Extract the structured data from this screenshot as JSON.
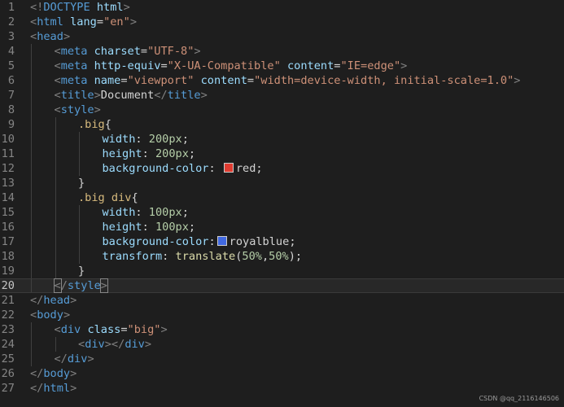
{
  "editor": {
    "current_line": 20,
    "lines": [
      {
        "n": "1",
        "t": [
          [
            "br",
            "<!"
          ],
          [
            "tag",
            "DOCTYPE"
          ],
          [
            "txt",
            " "
          ],
          [
            "attr",
            "html"
          ],
          [
            "br",
            ">"
          ]
        ]
      },
      {
        "n": "2",
        "t": [
          [
            "br",
            "<"
          ],
          [
            "tag",
            "html"
          ],
          [
            "txt",
            " "
          ],
          [
            "attr",
            "lang"
          ],
          [
            "txt",
            "="
          ],
          [
            "str",
            "\"en\""
          ],
          [
            "br",
            ">"
          ]
        ]
      },
      {
        "n": "3",
        "t": [
          [
            "br",
            "<"
          ],
          [
            "tag",
            "head"
          ],
          [
            "br",
            ">"
          ]
        ]
      },
      {
        "n": "4",
        "i": 1,
        "t": [
          [
            "br",
            "<"
          ],
          [
            "tag",
            "meta"
          ],
          [
            "txt",
            " "
          ],
          [
            "attr",
            "charset"
          ],
          [
            "txt",
            "="
          ],
          [
            "str",
            "\"UTF-8\""
          ],
          [
            "br",
            ">"
          ]
        ]
      },
      {
        "n": "5",
        "i": 1,
        "t": [
          [
            "br",
            "<"
          ],
          [
            "tag",
            "meta"
          ],
          [
            "txt",
            " "
          ],
          [
            "attr",
            "http-equiv"
          ],
          [
            "txt",
            "="
          ],
          [
            "str",
            "\"X-UA-Compatible\""
          ],
          [
            "txt",
            " "
          ],
          [
            "attr",
            "content"
          ],
          [
            "txt",
            "="
          ],
          [
            "str",
            "\"IE=edge\""
          ],
          [
            "br",
            ">"
          ]
        ]
      },
      {
        "n": "6",
        "i": 1,
        "t": [
          [
            "br",
            "<"
          ],
          [
            "tag",
            "meta"
          ],
          [
            "txt",
            " "
          ],
          [
            "attr",
            "name"
          ],
          [
            "txt",
            "="
          ],
          [
            "str",
            "\"viewport\""
          ],
          [
            "txt",
            " "
          ],
          [
            "attr",
            "content"
          ],
          [
            "txt",
            "="
          ],
          [
            "str",
            "\"width=device-width, initial-scale=1.0\""
          ],
          [
            "br",
            ">"
          ]
        ]
      },
      {
        "n": "7",
        "i": 1,
        "t": [
          [
            "br",
            "<"
          ],
          [
            "tag",
            "title"
          ],
          [
            "br",
            ">"
          ],
          [
            "txt",
            "Document"
          ],
          [
            "br",
            "</"
          ],
          [
            "tag",
            "title"
          ],
          [
            "br",
            ">"
          ]
        ]
      },
      {
        "n": "8",
        "i": 1,
        "t": [
          [
            "br",
            "<"
          ],
          [
            "tag",
            "style"
          ],
          [
            "br",
            ">"
          ]
        ]
      },
      {
        "n": "9",
        "i": 2,
        "t": [
          [
            "sel",
            ".big"
          ],
          [
            "punc",
            "{"
          ]
        ]
      },
      {
        "n": "10",
        "i": 3,
        "t": [
          [
            "prop",
            "width"
          ],
          [
            "punc",
            ": "
          ],
          [
            "num",
            "200px"
          ],
          [
            "punc",
            ";"
          ]
        ]
      },
      {
        "n": "11",
        "i": 3,
        "t": [
          [
            "prop",
            "height"
          ],
          [
            "punc",
            ": "
          ],
          [
            "num",
            "200px"
          ],
          [
            "punc",
            ";"
          ]
        ]
      },
      {
        "n": "12",
        "i": 3,
        "t": [
          [
            "prop",
            "background-color"
          ],
          [
            "punc",
            ": "
          ],
          [
            "swatch",
            "#e03c31"
          ],
          [
            "txt",
            "red"
          ],
          [
            "punc",
            ";"
          ]
        ]
      },
      {
        "n": "13",
        "i": 2,
        "t": [
          [
            "punc",
            "}"
          ]
        ]
      },
      {
        "n": "14",
        "i": 2,
        "t": [
          [
            "sel",
            ".big div"
          ],
          [
            "punc",
            "{"
          ]
        ]
      },
      {
        "n": "15",
        "i": 3,
        "t": [
          [
            "prop",
            "width"
          ],
          [
            "punc",
            ": "
          ],
          [
            "num",
            "100px"
          ],
          [
            "punc",
            ";"
          ]
        ]
      },
      {
        "n": "16",
        "i": 3,
        "t": [
          [
            "prop",
            "height"
          ],
          [
            "punc",
            ": "
          ],
          [
            "num",
            "100px"
          ],
          [
            "punc",
            ";"
          ]
        ]
      },
      {
        "n": "17",
        "i": 3,
        "t": [
          [
            "prop",
            "background-color"
          ],
          [
            "punc",
            ":"
          ],
          [
            "swatch",
            "#4169e1"
          ],
          [
            "txt",
            "royalblue"
          ],
          [
            "punc",
            ";"
          ]
        ]
      },
      {
        "n": "18",
        "i": 3,
        "t": [
          [
            "prop",
            "transform"
          ],
          [
            "punc",
            ": "
          ],
          [
            "fn",
            "translate"
          ],
          [
            "punc",
            "("
          ],
          [
            "num",
            "50%"
          ],
          [
            "punc",
            ","
          ],
          [
            "num",
            "50%"
          ],
          [
            "punc",
            ");"
          ]
        ]
      },
      {
        "n": "19",
        "i": 2,
        "t": [
          [
            "punc",
            "}"
          ]
        ]
      },
      {
        "n": "20",
        "i": 1,
        "t": [
          [
            "brm",
            "<"
          ],
          [
            "br",
            "/"
          ],
          [
            "tag",
            "style"
          ],
          [
            "brm",
            ">"
          ]
        ]
      },
      {
        "n": "21",
        "t": [
          [
            "br",
            "</"
          ],
          [
            "tag",
            "head"
          ],
          [
            "br",
            ">"
          ]
        ]
      },
      {
        "n": "22",
        "t": [
          [
            "br",
            "<"
          ],
          [
            "tag",
            "body"
          ],
          [
            "br",
            ">"
          ]
        ]
      },
      {
        "n": "23",
        "i": 1,
        "t": [
          [
            "br",
            "<"
          ],
          [
            "tag",
            "div"
          ],
          [
            "txt",
            " "
          ],
          [
            "attr",
            "class"
          ],
          [
            "txt",
            "="
          ],
          [
            "str",
            "\"big\""
          ],
          [
            "br",
            ">"
          ]
        ]
      },
      {
        "n": "24",
        "i": 2,
        "t": [
          [
            "br",
            "<"
          ],
          [
            "tag",
            "div"
          ],
          [
            "br",
            "></"
          ],
          [
            "tag",
            "div"
          ],
          [
            "br",
            ">"
          ]
        ]
      },
      {
        "n": "25",
        "i": 1,
        "t": [
          [
            "br",
            "</"
          ],
          [
            "tag",
            "div"
          ],
          [
            "br",
            ">"
          ]
        ]
      },
      {
        "n": "26",
        "t": [
          [
            "br",
            "</"
          ],
          [
            "tag",
            "body"
          ],
          [
            "br",
            ">"
          ]
        ]
      },
      {
        "n": "27",
        "t": [
          [
            "br",
            "</"
          ],
          [
            "tag",
            "html"
          ],
          [
            "br",
            ">"
          ]
        ]
      }
    ]
  },
  "watermark": "CSDN @qq_2116146506"
}
